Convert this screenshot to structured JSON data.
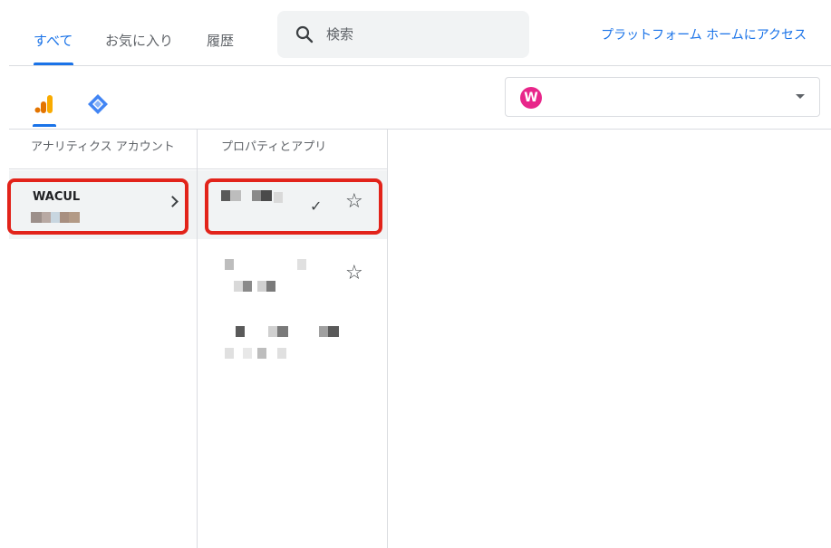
{
  "header": {
    "tabs": [
      {
        "label": "すべて",
        "active": true
      },
      {
        "label": "お気に入り",
        "active": false
      },
      {
        "label": "履歴",
        "active": false
      }
    ],
    "search": {
      "placeholder": "検索",
      "icon": "search-icon"
    },
    "platform_link": "プラットフォーム ホームにアクセス"
  },
  "products": [
    {
      "icon": "analytics-icon",
      "active": true,
      "color": "#f9ab00"
    },
    {
      "icon": "tag-manager-icon",
      "active": false,
      "color": "#4285f4"
    }
  ],
  "account_selector": {
    "avatar_letter": "W",
    "avatar_color": "#e8268a",
    "icon": "chevron-down-icon"
  },
  "columns": {
    "accounts": {
      "header": "アナリティクス アカウント",
      "items": [
        {
          "name": "WACUL",
          "selected": true
        }
      ]
    },
    "properties": {
      "header": "プロパティとアプリ",
      "items": [
        {
          "selected": true,
          "checked": true,
          "favorite": false
        },
        {
          "selected": false,
          "checked": false,
          "favorite": false
        },
        {
          "selected": false,
          "checked": false,
          "favorite": false
        }
      ]
    }
  },
  "colors": {
    "accent": "#1a73e8",
    "highlight": "#e2231a",
    "selected_bg": "#f1f3f4"
  },
  "icons": {
    "check": "✓",
    "star": "☆",
    "chevron": "›"
  }
}
